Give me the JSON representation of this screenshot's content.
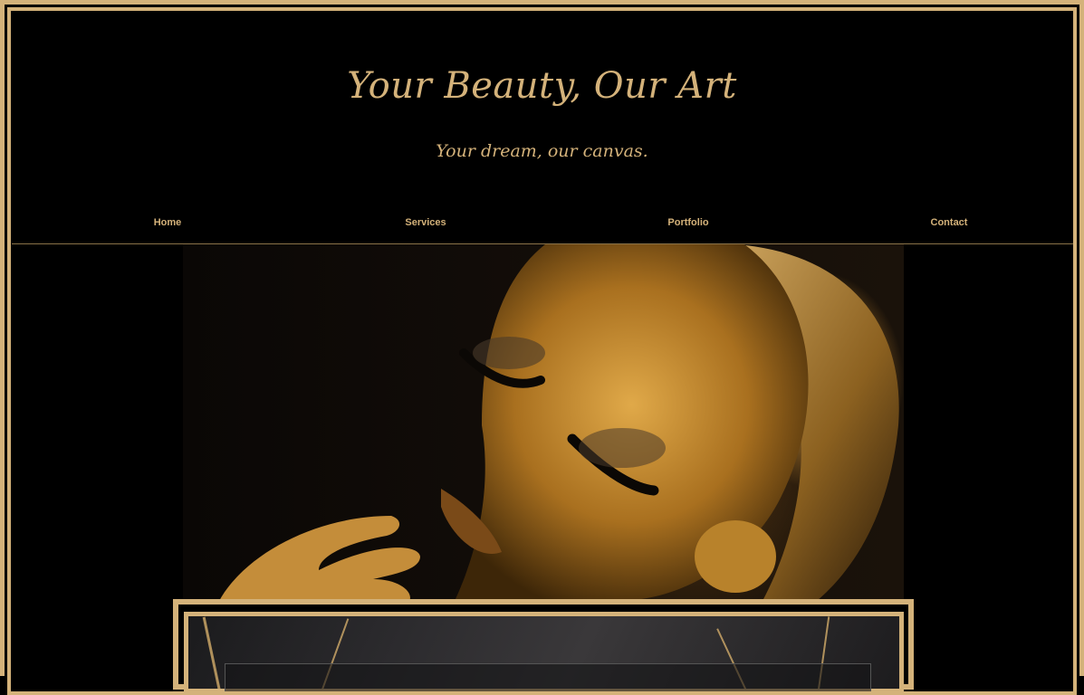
{
  "hero": {
    "title": "Your Beauty, Our Art",
    "subtitle": "Your dream, our canvas."
  },
  "nav": {
    "items": [
      {
        "label": "Home"
      },
      {
        "label": "Services"
      },
      {
        "label": "Portfolio"
      },
      {
        "label": "Contact"
      }
    ]
  },
  "theme": {
    "accent": "#d4b27a",
    "background": "#000000"
  },
  "images": {
    "hero_image": "golden-makeup-portrait",
    "card_background": "black-gold-marble-texture"
  }
}
